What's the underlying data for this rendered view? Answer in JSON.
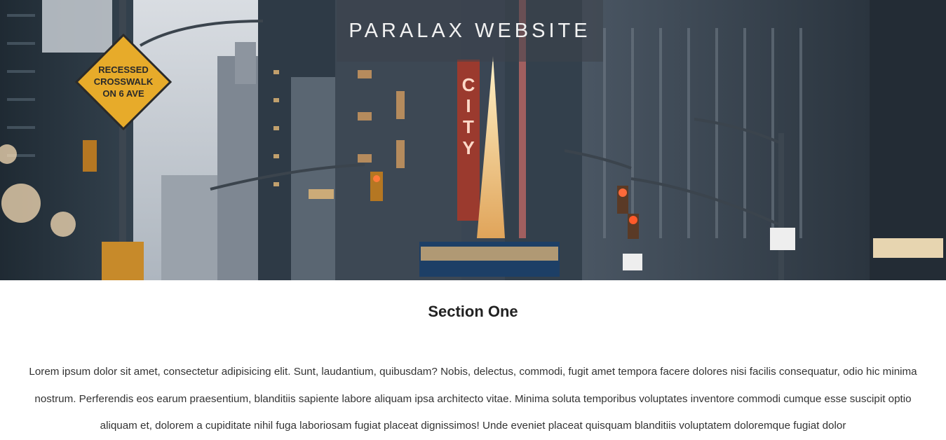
{
  "hero": {
    "title": "PARALAX WEBSITE",
    "image_description": "city street at dusk with skyscrapers, traffic lights and a lit tree",
    "sign_text": [
      "RECESSED",
      "CROSSWALK",
      "ON 6 AVE"
    ],
    "marquee_text": "CITY"
  },
  "section_one": {
    "title": "Section One",
    "text": "Lorem ipsum dolor sit amet, consectetur adipisicing elit. Sunt, laudantium, quibusdam? Nobis, delectus, commodi, fugit amet tempora facere dolores nisi facilis consequatur, odio hic minima nostrum. Perferendis eos earum praesentium, blanditiis sapiente labore aliquam ipsa architecto vitae. Minima soluta temporibus voluptates inventore commodi cumque esse suscipit optio aliquam et, dolorem a cupiditate nihil fuga laboriosam fugiat placeat dignissimos! Unde eveniet placeat quisquam blanditiis voluptatem doloremque fugiat dolor"
  }
}
